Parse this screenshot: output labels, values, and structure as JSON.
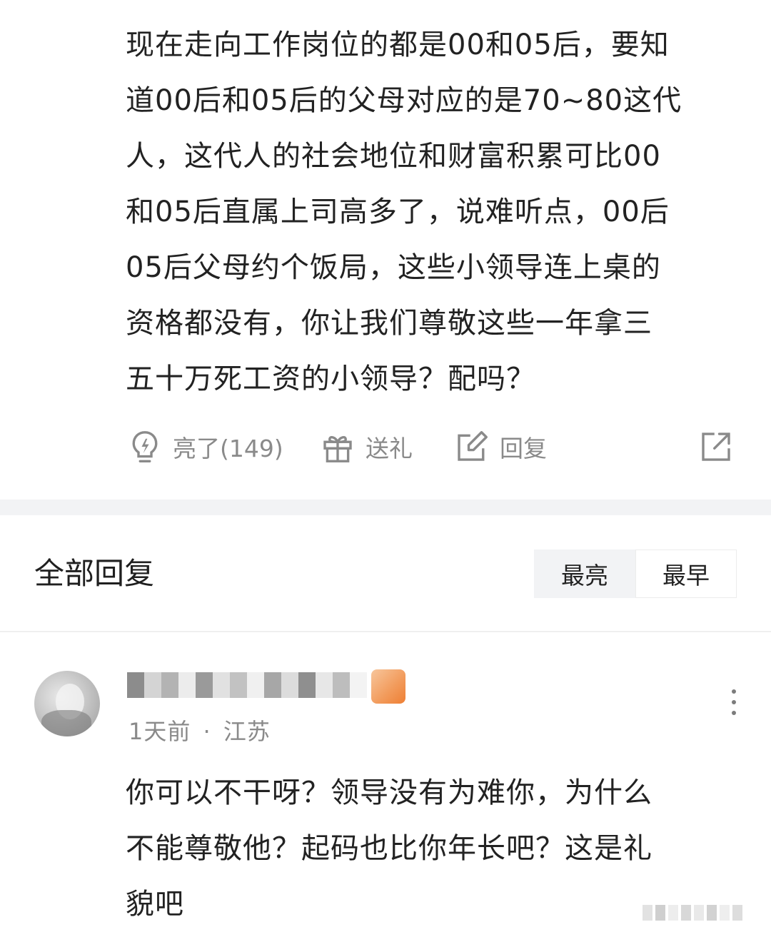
{
  "post": {
    "lines": [
      "现在走向工作岗位的都是00和05后，要知",
      "道00后和05后的父母对应的是70~80这代",
      "人，这代人的社会地位和财富积累可比00",
      "和05后直属上司高多了，说难听点，00后",
      "05后父母约个饭局，这些小领导连上桌的",
      "资格都没有，你让我们尊敬这些一年拿三",
      "五十万死工资的小领导？配吗？"
    ],
    "actions": {
      "like_label": "亮了(149)",
      "gift_label": "送礼",
      "reply_label": "回复"
    },
    "icons": [
      "lightbulb-icon",
      "gift-icon",
      "edit-icon",
      "share-icon"
    ]
  },
  "replies_section": {
    "title": "全部回复",
    "sort_tabs": [
      "最亮",
      "最早"
    ],
    "active_sort": "最早"
  },
  "reply": {
    "username": "",
    "time": "1天前",
    "separator": "·",
    "location": "江苏",
    "lines": [
      "你可以不干呀？领导没有为难你，为什么",
      "不能尊敬他？起码也比你年长吧？这是礼",
      "貌吧"
    ]
  },
  "colors": {
    "text": "#222222",
    "muted": "#8a8a8a",
    "band": "#f2f3f5",
    "badge": "#f29a5a"
  }
}
